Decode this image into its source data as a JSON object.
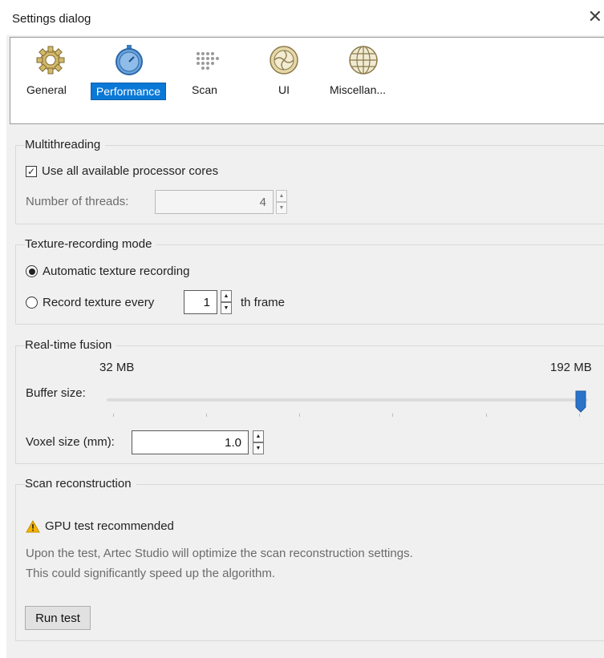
{
  "window": {
    "title": "Settings dialog",
    "close_glyph": "✕"
  },
  "toolbar": {
    "items": [
      {
        "label": "General",
        "icon": "gear-icon",
        "selected": false
      },
      {
        "label": "Performance",
        "icon": "stopwatch-icon",
        "selected": true
      },
      {
        "label": "Scan",
        "icon": "dot-grid-icon",
        "selected": false
      },
      {
        "label": "UI",
        "icon": "aperture-icon",
        "selected": false
      },
      {
        "label": "Miscellan...",
        "icon": "globe-icon",
        "selected": false
      }
    ]
  },
  "multithreading": {
    "title": "Multithreading",
    "use_all_cores_label": "Use all available processor cores",
    "use_all_cores_checked": true,
    "threads_label": "Number of threads:",
    "threads_value": "4"
  },
  "texture": {
    "title": "Texture-recording mode",
    "auto_label": "Automatic texture recording",
    "every_label": "Record texture every",
    "every_value": "1",
    "frame_suffix": "th frame",
    "selected": "auto"
  },
  "fusion": {
    "title": "Real-time fusion",
    "min_label": "32 MB",
    "max_label": "192 MB",
    "buffer_label": "Buffer size:",
    "buffer_fraction": 1.0,
    "voxel_label": "Voxel size (mm):",
    "voxel_value": "1.0"
  },
  "reconstruction": {
    "title": "Scan reconstruction",
    "warning": "GPU test recommended",
    "desc_line1": "Upon the test, Artec Studio will optimize the scan reconstruction settings.",
    "desc_line2": "This could significantly speed up the algorithm.",
    "run_label": "Run test"
  },
  "colors": {
    "accent": "#0a78d7",
    "slider_handle": "#2a73c9",
    "warning": "#f4b400"
  }
}
